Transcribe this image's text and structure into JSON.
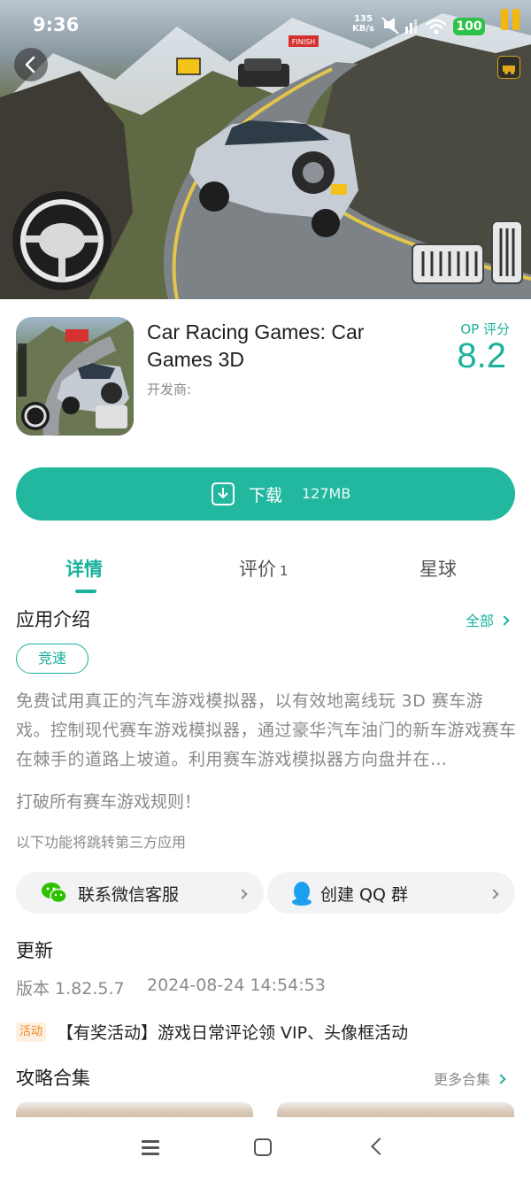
{
  "status_bar": {
    "time": "9:36",
    "net_speed": "135",
    "net_unit": "KB/s",
    "battery": "100"
  },
  "app": {
    "title": "Car Racing Games: Car Games 3D",
    "developer_label": "开发商:",
    "score_label": "OP 评分",
    "score_value": "8.2"
  },
  "download": {
    "label": "下载",
    "size": "127MB"
  },
  "tabs": [
    {
      "label": "详情",
      "active": true
    },
    {
      "label": "评价",
      "count": "1"
    },
    {
      "label": "星球"
    }
  ],
  "intro": {
    "title": "应用介绍",
    "more_label": "全部",
    "tag": "竞速",
    "description": "免费试用真正的汽车游戏模拟器，以有效地离线玩 3D 赛车游戏。控制现代赛车游戏模拟器，通过豪华汽车油门的新车游戏赛车在棘手的道路上坡道。利用赛车游戏模拟器方向盘并在…",
    "extra": "打破所有赛车游戏规则！",
    "third_party_note": "以下功能将跳转第三方应用"
  },
  "contacts": [
    {
      "label": "联系微信客服"
    },
    {
      "label": "创建 QQ 群"
    }
  ],
  "update": {
    "title": "更新",
    "version": "版本 1.82.5.7",
    "date": "2024-08-24 14:54:53",
    "activity_tag": "活动",
    "activity_text": "【有奖活动】游戏日常评论领 VIP、头像框活动"
  },
  "guides": {
    "title": "攻略合集",
    "more_label": "更多合集"
  },
  "hero": {
    "finish_sign": "FINISH"
  },
  "colors": {
    "accent": "#1ab19c",
    "download_button": "#22b8a0",
    "battery": "#2fc24a",
    "activity_tag": "#f0862a"
  }
}
